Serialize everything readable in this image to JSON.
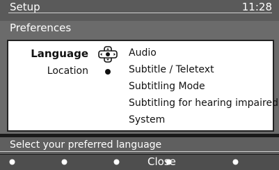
{
  "header": {
    "title": "Setup",
    "clock": "11:28",
    "subtitle": "Preferences"
  },
  "menu": {
    "left_items": [
      {
        "label": "Language",
        "icon": "navigation-cross-icon",
        "selected": true
      },
      {
        "label": "Location",
        "icon": "bullet-icon",
        "selected": false
      }
    ],
    "right_items": [
      {
        "label": "Audio"
      },
      {
        "label": "Subtitle / Teletext"
      },
      {
        "label": "Subtitling Mode"
      },
      {
        "label": "Subtitling for hearing impaired"
      },
      {
        "label": "System"
      }
    ]
  },
  "status": {
    "text": "Select your preferred language"
  },
  "buttons": {
    "close_label": "Close",
    "colors": {
      "background": "#4e4e4e",
      "dot": "#ffffff"
    }
  }
}
